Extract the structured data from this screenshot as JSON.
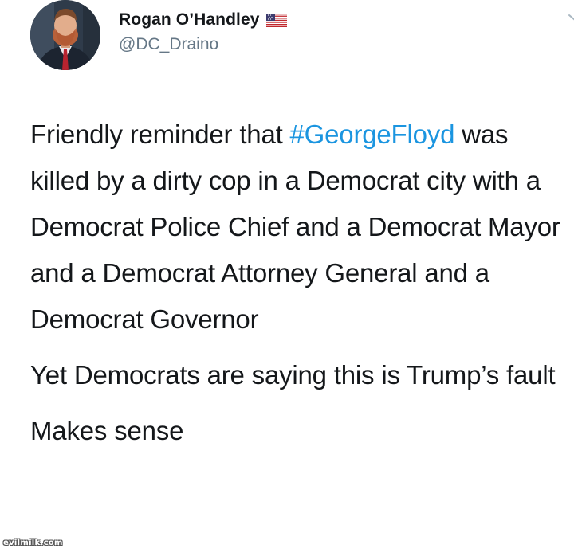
{
  "tweet": {
    "author": {
      "display_name": "Rogan O’Handley",
      "handle": "@DC_Draino",
      "flag_icon": "us-flag-icon",
      "avatar_icon": "profile-photo-avatar"
    },
    "menu_icon": "chevron-down-icon",
    "body": {
      "line1_before": "Friendly reminder that ",
      "hashtag": "#GeorgeFloyd",
      "line1_after": " was killed by a dirty cop in a Democrat city with a Democrat Police Chief and a Democrat Mayor and a Democrat Attorney General and a Democrat Governor",
      "paragraph2": "Yet Democrats are saying this is Trump’s fault",
      "paragraph3": "Makes sense"
    },
    "colors": {
      "hashtag": "#1b95e0",
      "text": "#14171a",
      "handle": "#657786"
    }
  },
  "watermark": {
    "text": "evilmilk.com"
  }
}
